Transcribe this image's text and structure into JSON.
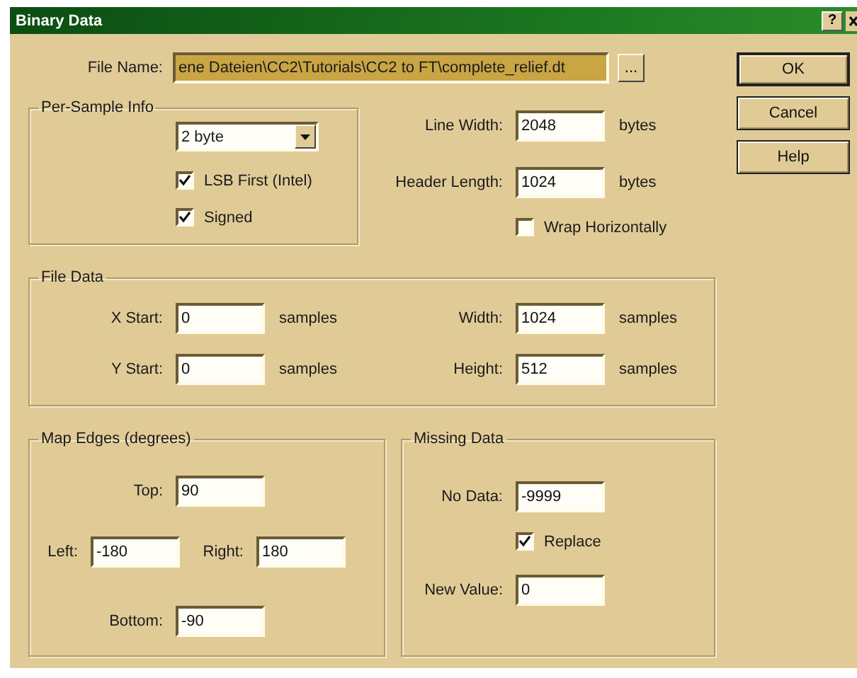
{
  "window": {
    "title": "Binary Data",
    "help_button": "?"
  },
  "file_name": {
    "label": "File Name:",
    "value": "ene Dateien\\CC2\\Tutorials\\CC2 to FT\\complete_relief.dt",
    "browse_button": "..."
  },
  "buttons": [
    {
      "label": "OK",
      "default": true
    },
    {
      "label": "Cancel",
      "default": false
    },
    {
      "label": "Help",
      "default": false
    }
  ],
  "per_sample_info": {
    "title": "Per-Sample Info",
    "sample_size": "2 byte",
    "options": [
      {
        "label": "LSB First (Intel)",
        "checked": true
      },
      {
        "label": "Signed",
        "checked": true
      }
    ]
  },
  "line_fields": [
    {
      "label": "Line Width:",
      "value": "2048",
      "unit": "bytes"
    },
    {
      "label": "Header Length:",
      "value": "1024",
      "unit": "bytes"
    }
  ],
  "wrap_horizontally": {
    "label": "Wrap Horizontally",
    "checked": false
  },
  "file_data": {
    "title": "File Data",
    "fields": [
      {
        "label": "X Start:",
        "value": "0",
        "unit": "samples"
      },
      {
        "label": "Width:",
        "value": "1024",
        "unit": "samples"
      },
      {
        "label": "Y Start:",
        "value": "0",
        "unit": "samples"
      },
      {
        "label": "Height:",
        "value": "512",
        "unit": "samples"
      }
    ]
  },
  "map_edges": {
    "title": "Map Edges (degrees)",
    "top": {
      "label": "Top:",
      "value": "90"
    },
    "left": {
      "label": "Left:",
      "value": "-180"
    },
    "right": {
      "label": "Right:",
      "value": "180"
    },
    "bottom": {
      "label": "Bottom:",
      "value": "-90"
    }
  },
  "missing_data": {
    "title": "Missing Data",
    "no_data": {
      "label": "No Data:",
      "value": "-9999"
    },
    "replace": {
      "label": "Replace",
      "checked": true
    },
    "new_value": {
      "label": "New Value:",
      "value": "0"
    }
  }
}
